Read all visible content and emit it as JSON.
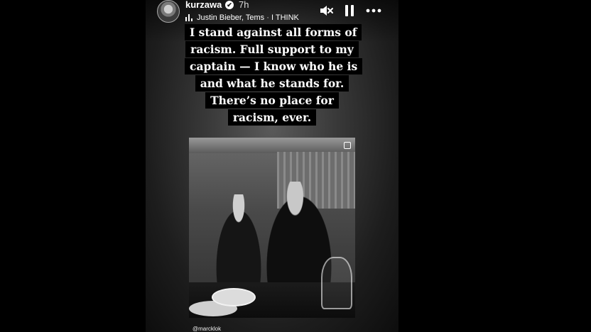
{
  "story": {
    "username": "kurzawa",
    "verified_mark": "✔",
    "time": "7h",
    "music": {
      "artist": "Justin Bieber, Tems",
      "separator": "·",
      "song": "I THINK"
    },
    "caption": "I stand against all forms of racism. Full support to my captain — I know who he is and what he stands for. There’s no place for racism, ever.",
    "photo_credit": "@marcklok"
  },
  "icons": {
    "mute": "speaker-muted-icon",
    "pause": "pause-icon",
    "more": "more-options-icon",
    "music": "music-bars-icon",
    "carousel": "multiple-images-icon"
  },
  "colors": {
    "page_background": "#000000",
    "caption_background": "#000000",
    "text": "#ffffff"
  }
}
